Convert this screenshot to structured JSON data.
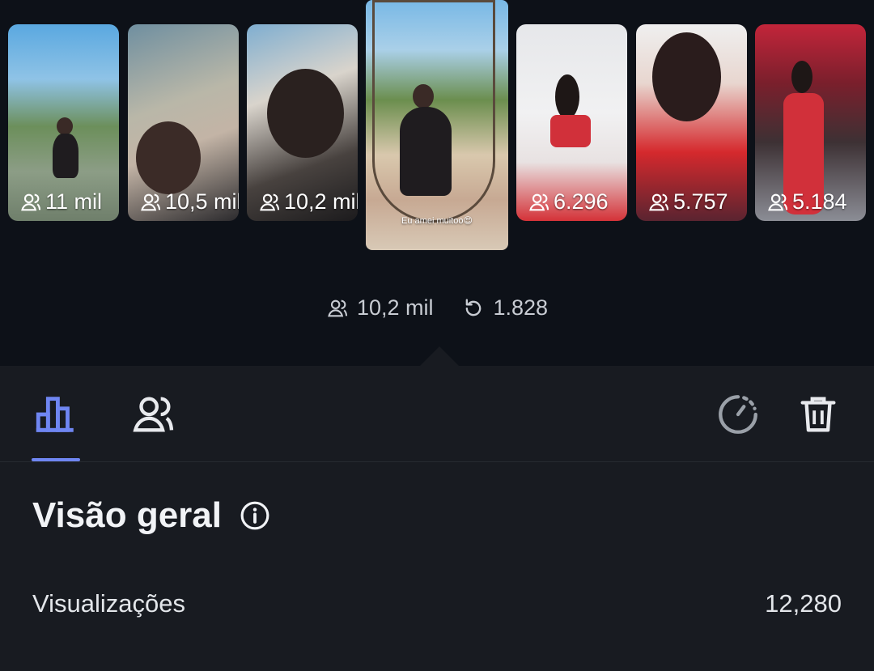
{
  "stories": [
    {
      "count": "11 mil"
    },
    {
      "count": "10,5 mil"
    },
    {
      "count": "10,2 mil"
    },
    {
      "caption": "Eu amei muitoo😍"
    },
    {
      "count": "6.296"
    },
    {
      "count": "5.757"
    },
    {
      "count": "5.184"
    }
  ],
  "selected_story": {
    "viewers": "10,2 mil",
    "replays": "1.828"
  },
  "toolbar": {
    "icons": [
      "bar-chart-icon",
      "viewers-icon",
      "timer-icon",
      "trash-icon"
    ],
    "accent_color": "#6f86f2"
  },
  "overview": {
    "title": "Visão geral",
    "rows": [
      {
        "label": "Visualizações",
        "value": "12,280"
      }
    ]
  }
}
